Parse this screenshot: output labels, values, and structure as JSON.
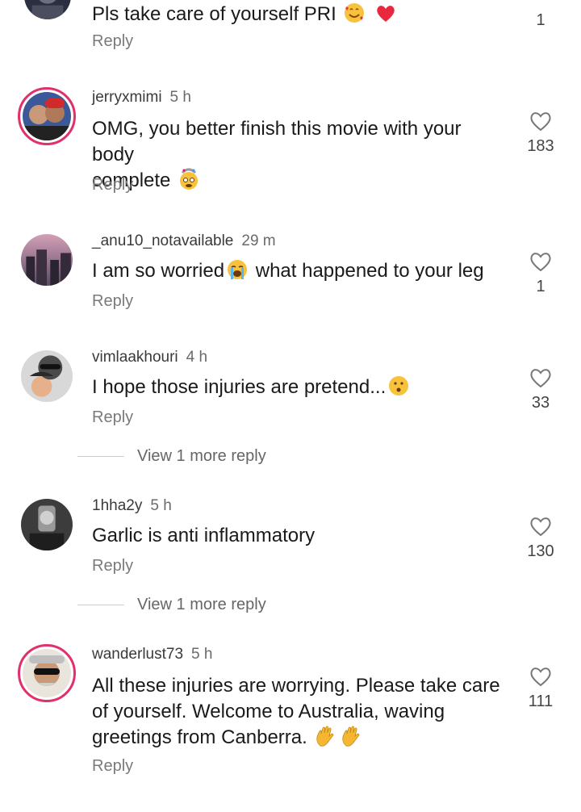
{
  "comments": [
    {
      "username": "",
      "time": "",
      "text": "Pls take care of yourself PRI",
      "reply": "Reply",
      "likes": "1",
      "emoji": [
        "smiling-face-with-hearts",
        "red-heart"
      ]
    },
    {
      "username": "jerryxmimi",
      "time": "5 h",
      "text_line1": "OMG, you better finish this movie with your body",
      "text_line2": "complete",
      "reply": "Reply",
      "likes": "183",
      "emoji": [
        "exploding-head"
      ]
    },
    {
      "username": "_anu10_notavailable",
      "time": "29 m",
      "text_a": "I am so worried",
      "text_b": "what happened to your leg",
      "reply": "Reply",
      "likes": "1",
      "emoji": [
        "loudly-crying-face"
      ]
    },
    {
      "username": "vimlaakhouri",
      "time": "4 h",
      "text": "I hope those injuries are pretend...",
      "reply": "Reply",
      "likes": "33",
      "more": "View 1 more reply",
      "emoji": [
        "hushed-face"
      ]
    },
    {
      "username": "1hha2y",
      "time": "5 h",
      "text": "Garlic is anti inflammatory",
      "reply": "Reply",
      "likes": "130",
      "more": "View 1 more reply"
    },
    {
      "username": "wanderlust73",
      "time": "5 h",
      "text_line1": "All these injuries are worrying. Please take care",
      "text_line2": "of yourself. Welcome to Australia, waving",
      "text_line3": "greetings from Canberra.",
      "reply": "Reply",
      "likes": "111",
      "emoji": [
        "waving-hand",
        "waving-hand"
      ]
    }
  ],
  "colors": {
    "story_ring": "#e1306c",
    "text": "#1a1a1a",
    "muted": "#7a7a7a"
  }
}
